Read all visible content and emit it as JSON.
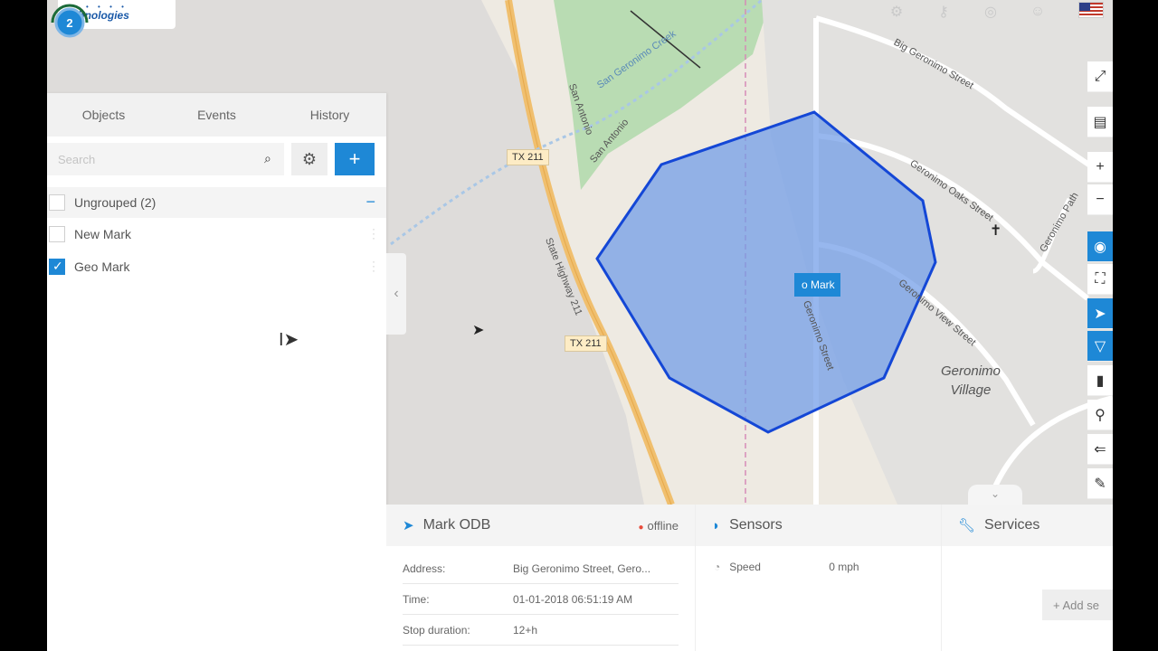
{
  "logo": {
    "text": "Technologies",
    "dots": "• • • • •"
  },
  "top_icons": [
    "settings-gears-icon",
    "key-icon",
    "help-icon",
    "user-icon"
  ],
  "tabs": [
    {
      "label": "Objects"
    },
    {
      "label": "Events"
    },
    {
      "label": "History"
    }
  ],
  "search": {
    "placeholder": "Search"
  },
  "add_button_label": "+",
  "groups": [
    {
      "label": "Ungrouped (2)",
      "items": [
        {
          "label": "New Mark",
          "checked": false
        },
        {
          "label": "Geo Mark",
          "checked": true
        }
      ]
    }
  ],
  "map": {
    "labels": {
      "tx211_a": "TX 211",
      "tx211_b": "TX 211",
      "state_highway": "State Highway 211",
      "creek": "San Geronimo Creek",
      "san_antonio_a": "San Antonio",
      "san_antonio_b": "San Antonio",
      "big_geronimo": "Big Geronimo Street",
      "geronimo_oaks": "Geronimo Oaks Street",
      "geronimo_path": "Geronimo Path",
      "geronimo_view": "Geronimo View Street",
      "geronimo_street": "Geronimo Street",
      "village_line1": "Geronimo",
      "village_line2": "Village"
    },
    "cluster_count": "2",
    "marker_label": "o Mark"
  },
  "object_card": {
    "title": "Mark ODB",
    "status": "offline",
    "rows": [
      {
        "key": "Address:",
        "value": "Big Geronimo Street, Gero..."
      },
      {
        "key": "Time:",
        "value": "01-01-2018 06:51:19 AM"
      },
      {
        "key": "Stop duration:",
        "value": "12+h"
      }
    ]
  },
  "sensors_card": {
    "title": "Sensors",
    "rows": [
      {
        "key": "Speed",
        "value": "0 mph"
      }
    ]
  },
  "services_card": {
    "title": "Services",
    "add_label": "+ Add se"
  },
  "colors": {
    "accent": "#1e88d6",
    "geofence_fill": "#6f9be8",
    "geofence_stroke": "#1447d6",
    "offline": "#e74c3c"
  }
}
